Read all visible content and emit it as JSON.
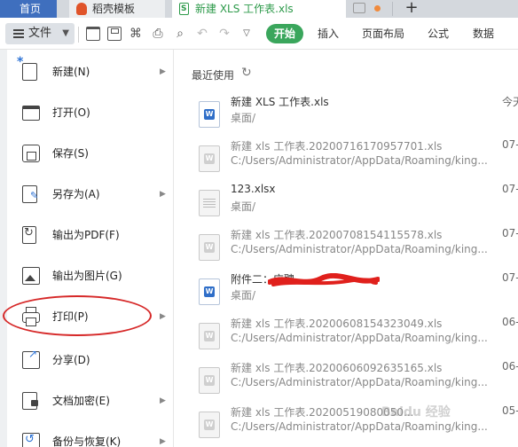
{
  "tabs": {
    "home": "首页",
    "daoke": "稻壳模板",
    "doc": "新建 XLS 工作表.xls"
  },
  "toolbar": {
    "file_label": "文件",
    "start_label": "开始",
    "menu_tabs": [
      "插入",
      "页面布局",
      "公式",
      "数据"
    ]
  },
  "file_menu": {
    "items": [
      {
        "label": "新建(N)",
        "icon": "new-doc-icon",
        "has_arrow": true
      },
      {
        "label": "打开(O)",
        "icon": "folder-icon",
        "has_arrow": false
      },
      {
        "label": "保存(S)",
        "icon": "save-icon",
        "has_arrow": false
      },
      {
        "label": "另存为(A)",
        "icon": "save-as-icon",
        "has_arrow": true
      },
      {
        "label": "输出为PDF(F)",
        "icon": "pdf-export-icon",
        "has_arrow": false
      },
      {
        "label": "输出为图片(G)",
        "icon": "image-export-icon",
        "has_arrow": false
      },
      {
        "label": "打印(P)",
        "icon": "printer-icon",
        "has_arrow": true
      },
      {
        "label": "分享(D)",
        "icon": "share-icon",
        "has_arrow": false
      },
      {
        "label": "文档加密(E)",
        "icon": "encrypt-icon",
        "has_arrow": true
      },
      {
        "label": "备份与恢复(K)",
        "icon": "backup-icon",
        "has_arrow": true
      }
    ]
  },
  "recent": {
    "title": "最近使用",
    "items": [
      {
        "name": "新建 XLS 工作表.xls",
        "path": "桌面/",
        "date": "今天"
      },
      {
        "name": "新建 xls 工作表.20200716170957701.xls",
        "path": "C:/Users/Administrator/AppData/Roaming/king...",
        "date": "07-"
      },
      {
        "name": "123.xlsx",
        "path": "桌面/",
        "date": "07-"
      },
      {
        "name": "新建 xls 工作表.20200708154115578.xls",
        "path": "C:/Users/Administrator/AppData/Roaming/king...",
        "date": "07-"
      },
      {
        "name": "附件二：应聘",
        "path": "桌面/",
        "date": "07-"
      },
      {
        "name": "新建 xls 工作表.20200608154323049.xls",
        "path": "C:/Users/Administrator/AppData/Roaming/king...",
        "date": "06-"
      },
      {
        "name": "新建 xls 工作表.20200606092635165.xls",
        "path": "C:/Users/Administrator/AppData/Roaming/king...",
        "date": "06-"
      },
      {
        "name": "新建 xls 工作表.20200519080050...",
        "path": "C:/Users/Administrator/AppData/Roaming/king...",
        "date": "05-"
      }
    ]
  },
  "watermark": "Baidu 经验",
  "colors": {
    "accent_green": "#3aa65c",
    "home_tab": "#3f6fbe",
    "annotation_red": "#d62828"
  }
}
